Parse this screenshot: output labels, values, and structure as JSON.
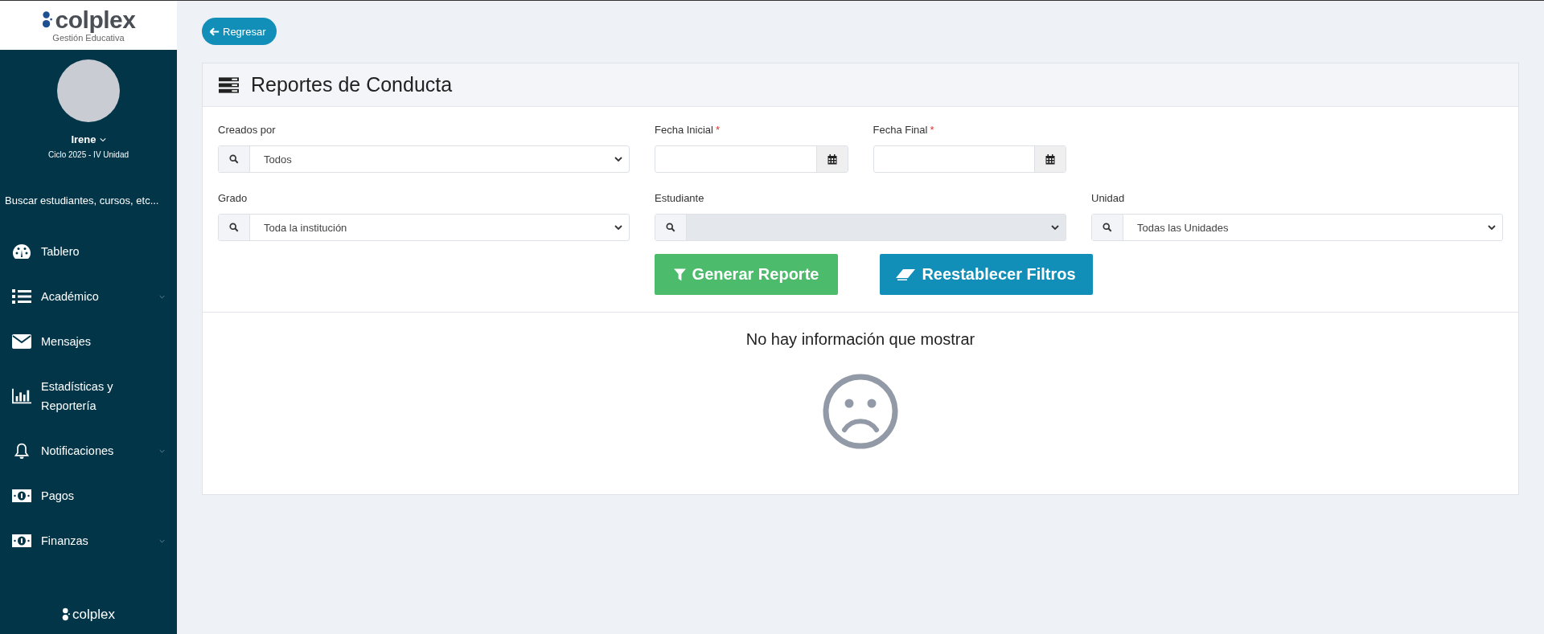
{
  "sidebar": {
    "logo": "colplex",
    "logo_subtitle": "Gestión Educativa",
    "user": {
      "name": "Irene",
      "cycle": "Ciclo 2025 - IV Unidad"
    },
    "search": {
      "placeholder": "Buscar estudiantes, cursos, etc..."
    },
    "items": [
      {
        "label": "Tablero",
        "kind": "dashboard",
        "has_submenu": false
      },
      {
        "label": "Académico",
        "kind": "list",
        "has_submenu": true
      },
      {
        "label": "Mensajes",
        "kind": "mail",
        "has_submenu": false
      },
      {
        "label": "Estadísticas y Reportería",
        "kind": "chart",
        "has_submenu": false
      },
      {
        "label": "Notificaciones",
        "kind": "bell",
        "has_submenu": true
      },
      {
        "label": "Pagos",
        "kind": "money",
        "has_submenu": false
      },
      {
        "label": "Finanzas",
        "kind": "money",
        "has_submenu": true
      }
    ],
    "footer_logo": "colplex"
  },
  "back_button": "Regresar",
  "panel": {
    "title": "Reportes de Conducta",
    "filter_rows": [
      [
        {
          "label": "Creados por",
          "kind": "select",
          "value": "Todos",
          "disabled": false
        },
        {
          "label": "Fecha Inicial",
          "kind": "date",
          "required_mark": "*",
          "disabled": false
        },
        {
          "label": "Fecha Final",
          "kind": "date",
          "required_mark": "*",
          "disabled": false
        }
      ],
      [
        {
          "label": "Grado",
          "kind": "select",
          "value": "Toda la institución",
          "disabled": false
        },
        {
          "label": "Estudiante",
          "kind": "select",
          "disabled": true
        },
        {
          "label": "Unidad",
          "kind": "select",
          "value": "Todas las Unidades",
          "disabled": false
        }
      ]
    ],
    "buttons": [
      {
        "label": "Generar Reporte",
        "kind": "generate"
      },
      {
        "label": "Reestablecer Filtros",
        "kind": "reset"
      }
    ],
    "empty_message": "No hay información que mostrar"
  }
}
